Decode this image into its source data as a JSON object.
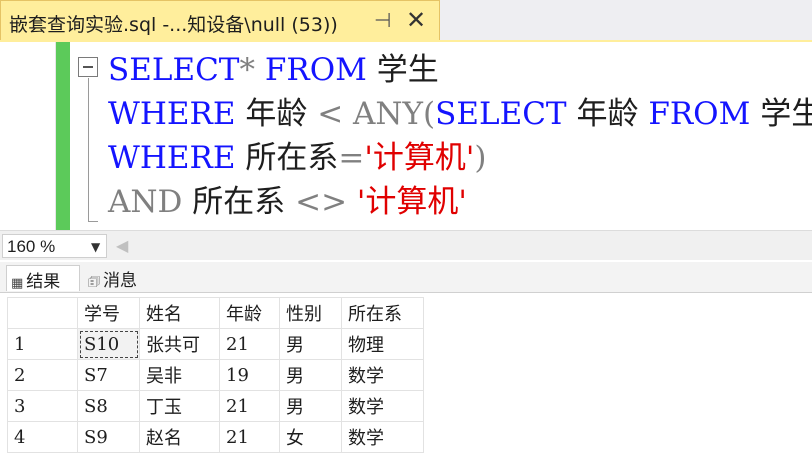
{
  "tab": {
    "title": "嵌套查询实验.sql -...知设备\\null (53))",
    "pin_glyph": "⊣",
    "close_glyph": "✕"
  },
  "editor": {
    "lines": [
      [
        {
          "t": "SELECT",
          "c": "kw"
        },
        {
          "t": "* ",
          "c": "op"
        },
        {
          "t": "FROM",
          "c": "kw"
        },
        {
          "t": " 学生",
          "c": "id"
        }
      ],
      [
        {
          "t": "WHERE",
          "c": "kw"
        },
        {
          "t": " 年龄 ",
          "c": "id"
        },
        {
          "t": "< ANY(",
          "c": "op"
        },
        {
          "t": "SELECT",
          "c": "kw"
        },
        {
          "t": " 年龄 ",
          "c": "id"
        },
        {
          "t": "FROM",
          "c": "kw"
        },
        {
          "t": " 学生",
          "c": "id"
        }
      ],
      [
        {
          "t": "WHERE",
          "c": "kw"
        },
        {
          "t": " 所在系",
          "c": "id"
        },
        {
          "t": "=",
          "c": "op"
        },
        {
          "t": "'计算机'",
          "c": "str"
        },
        {
          "t": ")",
          "c": "op"
        }
      ],
      [
        {
          "t": "AND",
          "c": "op"
        },
        {
          "t": " 所在系 ",
          "c": "id"
        },
        {
          "t": "<>",
          "c": "op"
        },
        {
          "t": " ",
          "c": "id"
        },
        {
          "t": "'计算机'",
          "c": "str"
        }
      ]
    ]
  },
  "zoom": {
    "value": "160 %"
  },
  "results_tabs": {
    "results_label": "结果",
    "messages_label": "消息"
  },
  "grid": {
    "columns": [
      "",
      "学号",
      "姓名",
      "年龄",
      "性别",
      "所在系"
    ],
    "rows": [
      [
        "1",
        "S10",
        "张共可",
        "21",
        "男",
        "物理"
      ],
      [
        "2",
        "S7",
        "吴非",
        "19",
        "男",
        "数学"
      ],
      [
        "3",
        "S8",
        "丁玉",
        "21",
        "男",
        "数学"
      ],
      [
        "4",
        "S9",
        "赵名",
        "21",
        "女",
        "数学"
      ]
    ]
  }
}
